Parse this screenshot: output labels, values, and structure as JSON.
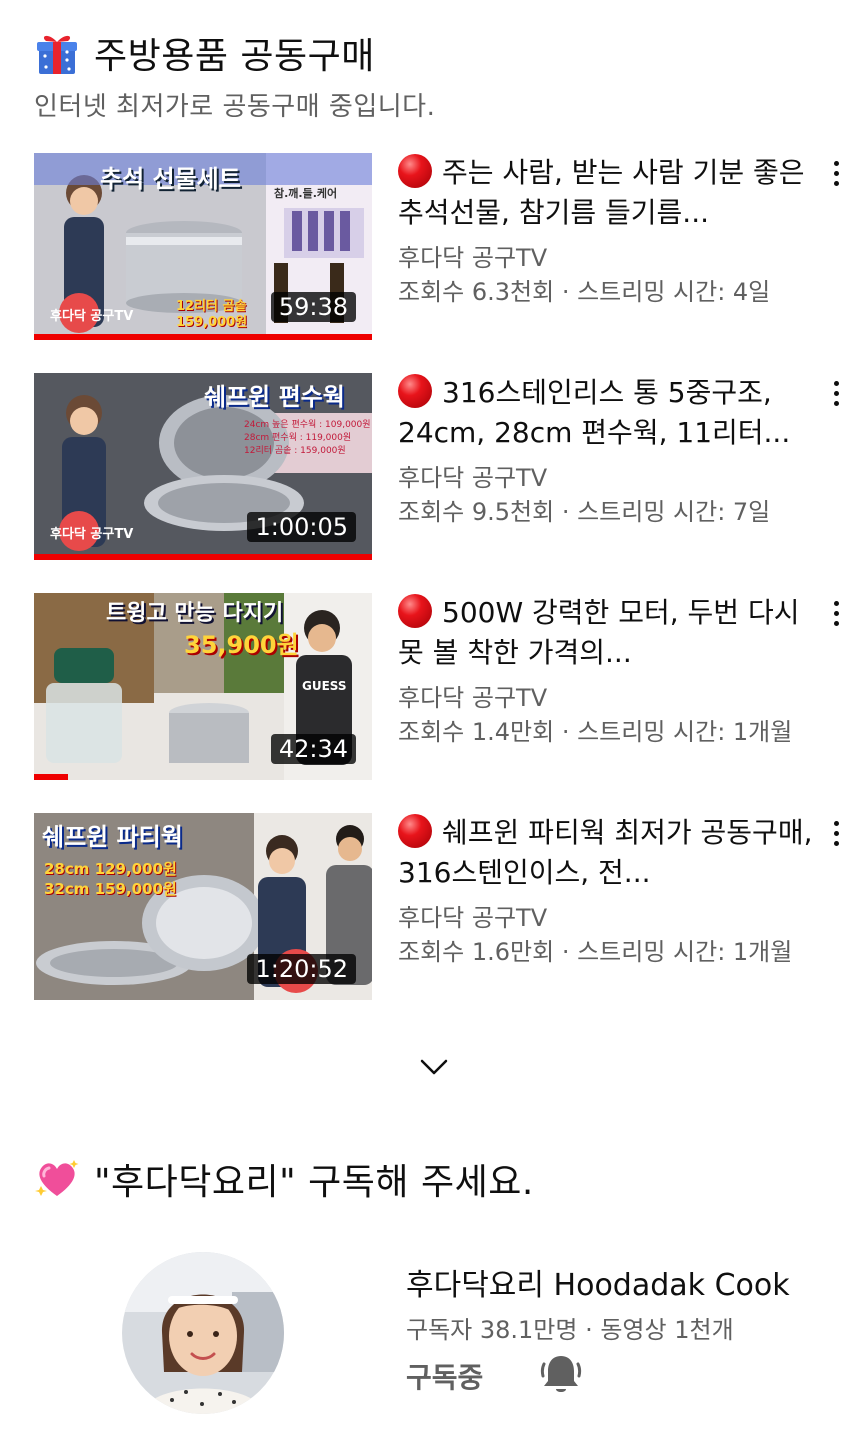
{
  "section": {
    "title": "주방용품 공동구매",
    "subtitle": "인터넷 최저가로 공동구매 중입니다.",
    "icon": "gift-icon"
  },
  "videos": [
    {
      "title": "주는 사람, 받는 사람 기분 좋은 추석선물, 참기름 들기름...",
      "channel": "후다닥 공구TV",
      "stats": "조회수 6.3천회 · 스트리밍 시간: 4일",
      "duration": "59:38",
      "thumb_text": "추석 선물세트",
      "thumb_price": "12리터 곰솥 159,000원",
      "thumb_badge": "후다닥 공구TV",
      "thumb_side_label": "참.깨.들.케어",
      "progress": 1.0
    },
    {
      "title": "316스테인리스 통 5중구조, 24cm, 28cm 편수웍, 11리터...",
      "channel": "후다닥 공구TV",
      "stats": "조회수 9.5천회 · 스트리밍 시간: 7일",
      "duration": "1:00:05",
      "thumb_text": "쉐프윈 편수웍",
      "thumb_price_lines": [
        "24cm 높은 편수웍 : 109,000원",
        "28cm 편수웍 : 119,000원",
        "12리터 곰솥 : 159,000원"
      ],
      "thumb_badge": "후다닥 공구TV",
      "progress": 1.0
    },
    {
      "title": "500W 강력한 모터, 두번 다시 못 볼 착한 가격의...",
      "channel": "후다닥 공구TV",
      "stats": "조회수 1.4만회 · 스트리밍 시간: 1개월",
      "duration": "42:34",
      "thumb_text": "트윙고 만능 다지기",
      "thumb_price": "35,900원",
      "thumb_shirt": "GUESS",
      "progress": 0.1
    },
    {
      "title": "쉐프윈 파티웍 최저가 공동구매, 316스텐인이스, 전...",
      "channel": "후다닥 공구TV",
      "stats": "조회수 1.6만회 · 스트리밍 시간: 1개월",
      "duration": "1:20:52",
      "thumb_text": "쉐프윈 파티웍",
      "thumb_price_lines": [
        "28cm 129,000원",
        "32cm 159,000원"
      ],
      "progress": 0
    }
  ],
  "subscribe": {
    "title": "\"후다닥요리\" 구독해 주세요.",
    "icon": "sparkling-heart-icon",
    "channel_name": "후다닥요리 Hoodadak Cook",
    "channel_stats": "구독자 38.1만명 · 동영상 1천개",
    "subscribed_label": "구독중"
  },
  "colors": {
    "live_red": "#e8141b",
    "secondary_text": "#606060",
    "progress_red": "#ee0000"
  }
}
